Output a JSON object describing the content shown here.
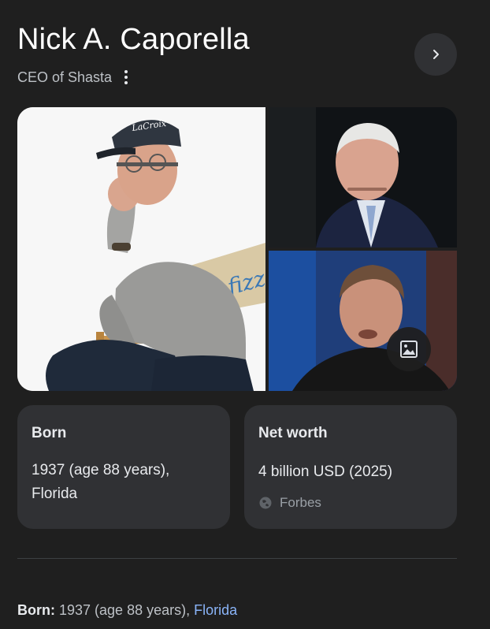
{
  "panel": {
    "title": "Nick A. Caporella",
    "subtitle": "CEO of Shasta"
  },
  "images": {
    "main_alt": "Man in LaCroix cap seated on a director's chair",
    "main_cap_text": "LaCroix",
    "main_chair_text": "fizz",
    "top_right_alt": "Older man in suit and tie",
    "bottom_right_alt": "Man speaking in a TV studio"
  },
  "cards": [
    {
      "label": "Born",
      "value_line1": "1937 (age 88 years),",
      "value_line2": "Florida"
    },
    {
      "label": "Net worth",
      "value": "4 billion USD (2025)",
      "source": "Forbes"
    }
  ],
  "born_row": {
    "label": "Born:",
    "text": " 1937 (age 88 years), ",
    "link": "Florida"
  },
  "colors": {
    "background": "#1f1f1f",
    "card": "#303134",
    "link": "#8ab4f8",
    "muted_text": "#bdc1c6"
  },
  "icons": [
    "more-vert-icon",
    "chevron-right-icon",
    "image-icon",
    "globe-icon"
  ]
}
